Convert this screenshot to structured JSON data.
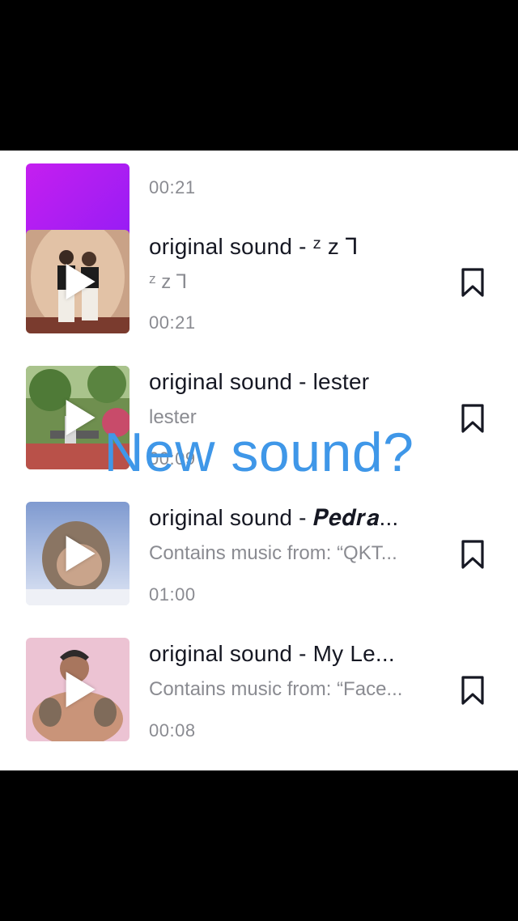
{
  "overlay": {
    "caption": "New sound?"
  },
  "sounds": [
    {
      "title": "",
      "subtitle": "",
      "duration": "00:21",
      "thumb": "purple-cover",
      "bookmark_visible": false
    },
    {
      "title": "original sound - ᶻ z ꓶ",
      "subtitle": "ᶻ z ꓶ",
      "duration": "00:21",
      "thumb": "couple-photo",
      "bookmark_visible": true
    },
    {
      "title": "original sound - lester",
      "subtitle": "lester",
      "duration": "00:09",
      "thumb": "park-photo",
      "bookmark_visible": true
    },
    {
      "title": "original sound - 𝑷𝒆𝒅𝒓𝒂...",
      "subtitle": "Contains music from: “QKT...",
      "duration": "01:00",
      "thumb": "monkey-photo",
      "bookmark_visible": true
    },
    {
      "title": "original sound - My Le...",
      "subtitle": "Contains music from: “Face...",
      "duration": "00:08",
      "thumb": "man-photo",
      "bookmark_visible": true
    }
  ],
  "colors": {
    "overlay_text": "#3f97e8",
    "title_text": "#161823",
    "secondary_text": "#8a8b91"
  }
}
